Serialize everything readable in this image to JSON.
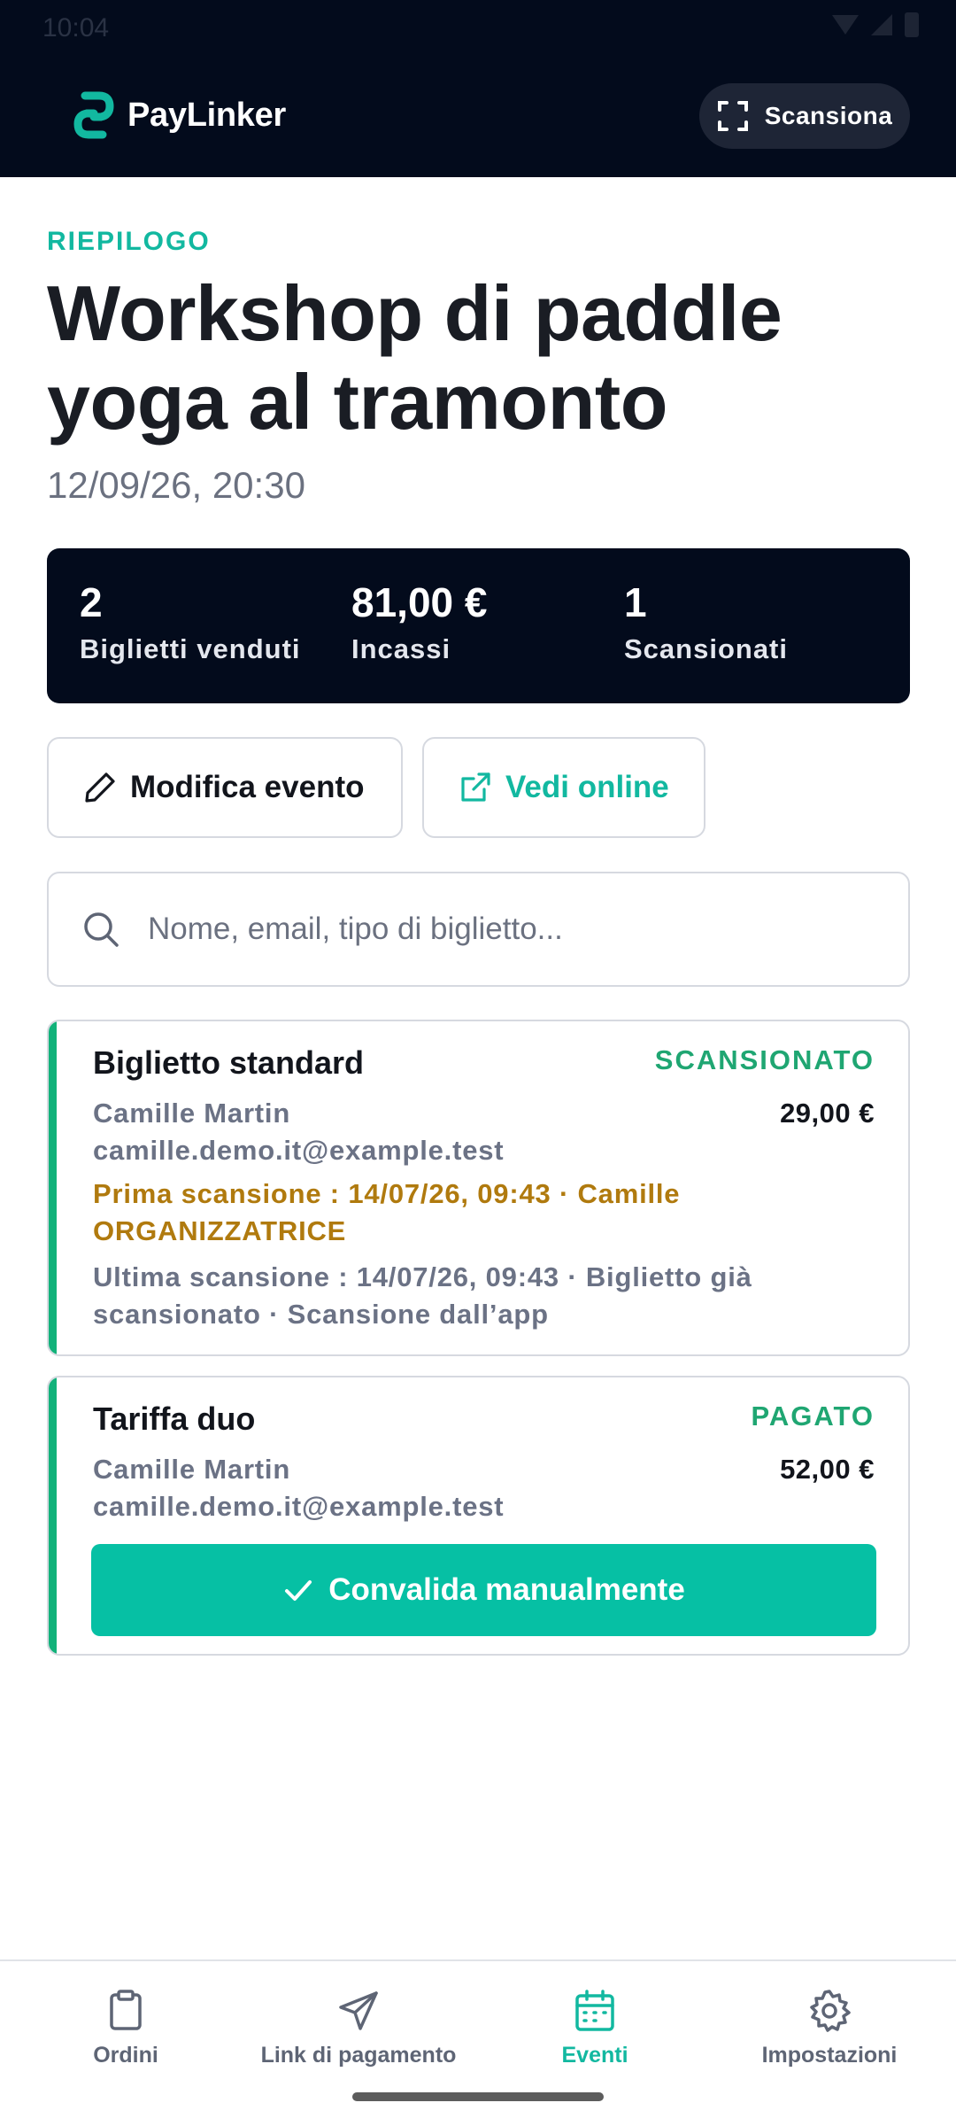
{
  "status_bar": {
    "time": "10:04"
  },
  "header": {
    "brand": "PayLinker",
    "scan_label": "Scansiona"
  },
  "event": {
    "eyebrow": "RIEPILOGO",
    "title": "Workshop di paddle yoga al tramonto",
    "datetime": "12/09/26, 20:30"
  },
  "stats": [
    {
      "value": "2",
      "label": "Biglietti venduti"
    },
    {
      "value": "81,00 €",
      "label": "Incassi"
    },
    {
      "value": "1",
      "label": "Scansionati"
    }
  ],
  "actions": {
    "edit_label": "Modifica evento",
    "view_label": "Vedi online"
  },
  "search": {
    "placeholder": "Nome, email, tipo di biglietto..."
  },
  "tickets": [
    {
      "type": "Biglietto standard",
      "status": "SCANSIONATO",
      "holder": "Camille Martin",
      "email": "camille.demo.it@example.test",
      "price": "29,00 €",
      "first_scan": "Prima scansione : 14/07/26, 09:43 · Camille ORGANIZZATRICE",
      "last_scan": "Ultima scansione : 14/07/26, 09:43 · Biglietto già scansionato · Scansione dall’app"
    },
    {
      "type": "Tariffa duo",
      "status": "PAGATO",
      "holder": "Camille Martin",
      "email": "camille.demo.it@example.test",
      "price": "52,00 €",
      "validate_label": "Convalida manualmente"
    }
  ],
  "nav": [
    {
      "label": "Ordini",
      "icon": "clipboard-icon"
    },
    {
      "label": "Link di pagamento",
      "icon": "send-icon"
    },
    {
      "label": "Eventi",
      "icon": "calendar-icon",
      "active": true
    },
    {
      "label": "Impostazioni",
      "icon": "gear-icon"
    }
  ],
  "colors": {
    "accent": "#12b8a0",
    "header_bg": "#030b1c",
    "status_green": "#1fa672",
    "scan_warning": "#b07a0e"
  }
}
